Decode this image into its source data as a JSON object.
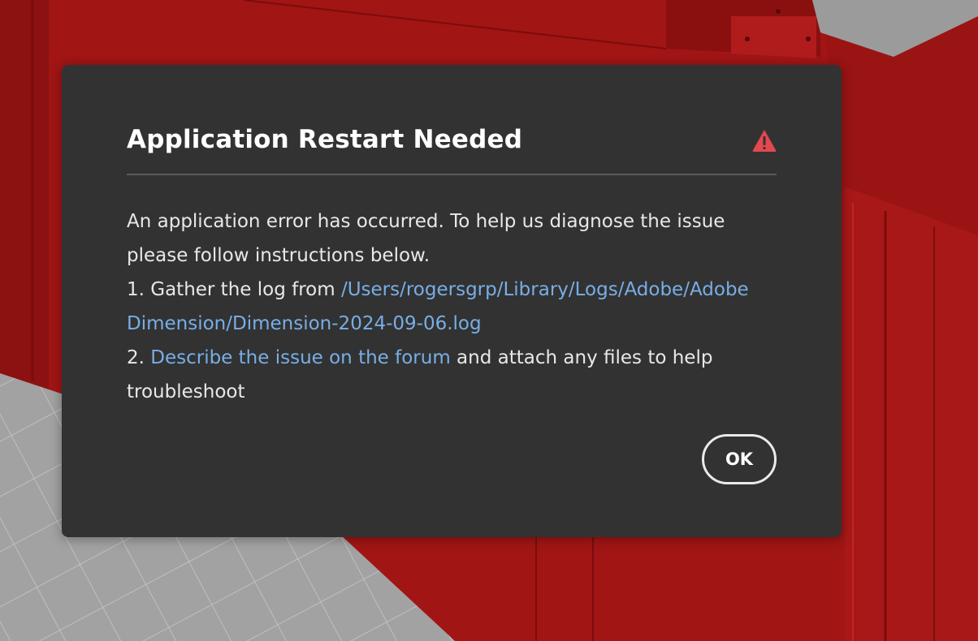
{
  "dialog": {
    "title": "Application Restart Needed",
    "icon": "alert-icon",
    "intro": "An application error has occurred. To help us diagnose the issue please follow instructions below.",
    "step1_prefix": "1. Gather the log from ",
    "step1_link": "/Users/rogersgrp/Library/Logs/Adobe/Adobe Dimension/Dimension-2024-09-06.log",
    "step2_prefix": "2. ",
    "step2_link": "Describe the issue on the forum",
    "step2_suffix": " and attach any files to help troubleshoot",
    "ok_label": "OK"
  },
  "colors": {
    "dialog_bg": "#323232",
    "link": "#78aee6",
    "alert": "#e34850",
    "scene_red": "#a11515",
    "floor_gray": "#9e9e9e"
  }
}
